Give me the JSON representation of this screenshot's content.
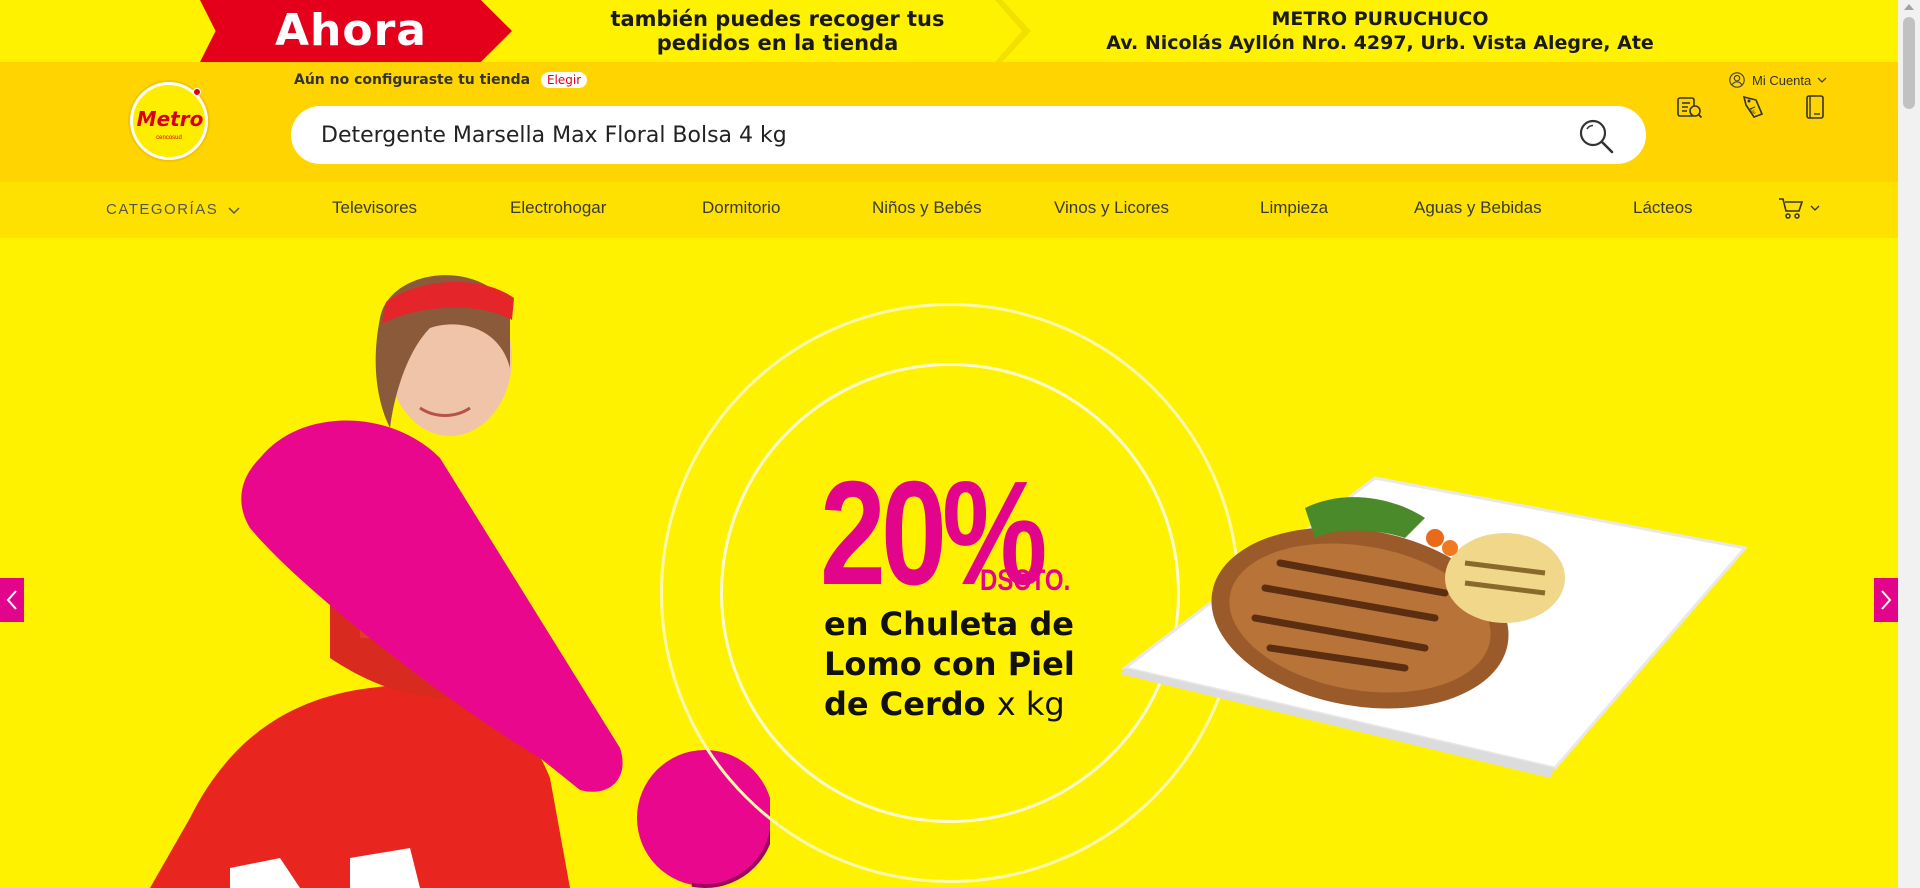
{
  "promo": {
    "badge": "Ahora",
    "message_line1": "también puedes recoger tus",
    "message_line2": "pedidos en la tienda",
    "store_name": "METRO PURUCHUCO",
    "store_address": "Av. Nicolás Ayllón Nro. 4297, Urb. Vista Alegre, Ate"
  },
  "header": {
    "logo_text": "Metro",
    "logo_subtext": "cencosud",
    "store_prompt": "Aún no configuraste tu tienda",
    "store_action": "Elegir",
    "account_label": "Mi Cuenta",
    "search_value": "Detergente Marsella Max Floral Bolsa 4 kg",
    "icons": [
      "search-icon",
      "order-tracking-icon",
      "coupons-icon",
      "catalog-icon"
    ]
  },
  "nav": {
    "categories_label": "CATEGORÍAS",
    "items": [
      "Televisores",
      "Electrohogar",
      "Dormitorio",
      "Niños y Bebés",
      "Vinos y Licores",
      "Limpieza",
      "Aguas y Bebidas",
      "Lácteos"
    ]
  },
  "hero": {
    "percent": "20%",
    "discount_label": "DSCTO.",
    "offer_line1": "en Chuleta de",
    "offer_line2": "Lomo con Piel",
    "offer_line3": "de Cerdo",
    "offer_unit": "x kg"
  },
  "colors": {
    "brand_yellow": "#ffed00",
    "header_yellow": "#ffd400",
    "brand_red": "#e4001b",
    "accent_magenta": "#e2058b"
  }
}
